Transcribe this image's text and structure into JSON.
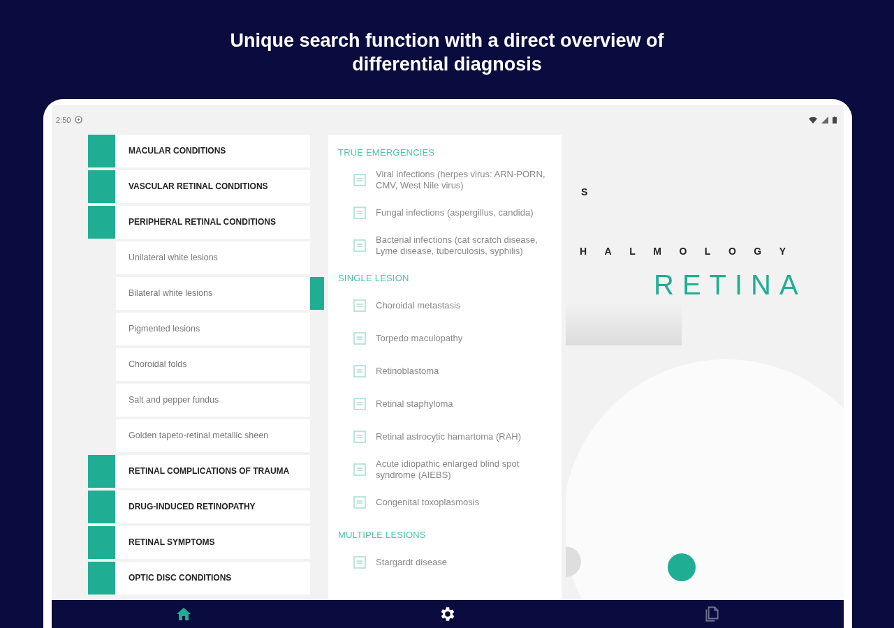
{
  "headline": [
    "Unique search function with a direct overview of",
    "differential diagnosis"
  ],
  "status_bar": {
    "time": "2:50"
  },
  "sidebar": {
    "items": [
      {
        "kind": "category",
        "label": "MACULAR CONDITIONS",
        "selected": false
      },
      {
        "kind": "category",
        "label": "VASCULAR RETINAL CONDITIONS",
        "selected": false
      },
      {
        "kind": "category",
        "label": "PERIPHERAL RETINAL CONDITIONS",
        "selected": false
      },
      {
        "kind": "item",
        "label": "Unilateral white lesions",
        "selected": false
      },
      {
        "kind": "item",
        "label": "Bilateral white lesions",
        "selected": true
      },
      {
        "kind": "item",
        "label": "Pigmented lesions",
        "selected": false
      },
      {
        "kind": "item",
        "label": "Choroidal folds",
        "selected": false
      },
      {
        "kind": "item",
        "label": "Salt and pepper fundus",
        "selected": false
      },
      {
        "kind": "item",
        "label": "Golden tapeto-retinal metallic sheen",
        "selected": false
      },
      {
        "kind": "category",
        "label": "RETINAL COMPLICATIONS OF TRAUMA",
        "selected": false
      },
      {
        "kind": "category",
        "label": "DRUG-INDUCED RETINOPATHY",
        "selected": false
      },
      {
        "kind": "category",
        "label": "RETINAL SYMPTOMS",
        "selected": false
      },
      {
        "kind": "category",
        "label": "OPTIC DISC CONDITIONS",
        "selected": false
      }
    ]
  },
  "diagnosis": {
    "sections": [
      {
        "title": "TRUE EMERGENCIES",
        "items": [
          "Viral infections (herpes virus: ARN-PORN, CMV, West Nile virus)",
          "Fungal infections (aspergillus, candida)",
          "Bacterial infections (cat scratch disease, Lyme disease, tuberculosis, syphilis)"
        ]
      },
      {
        "title": "SINGLE LESION",
        "items": [
          "Choroidal metastasis",
          "Torpedo maculopathy",
          "Retinoblastoma",
          "Retinal staphyloma",
          "Retinal astrocytic hamartoma (RAH)",
          "Acute idiopathic enlarged blind spot syndrome (AIEBS)",
          "Congenital toxoplasmosis"
        ]
      },
      {
        "title": "MULTIPLE LESIONS",
        "items": [
          "Stargardt disease"
        ]
      }
    ]
  },
  "logo": {
    "line_1": "S",
    "line_2": "HALMOLOGY",
    "line_3": "RETINA"
  },
  "nav": [
    {
      "kind": "home",
      "selected": true,
      "disabled": false
    },
    {
      "kind": "settings",
      "selected": false,
      "disabled": false
    },
    {
      "kind": "documents",
      "selected": false,
      "disabled": true
    }
  ]
}
